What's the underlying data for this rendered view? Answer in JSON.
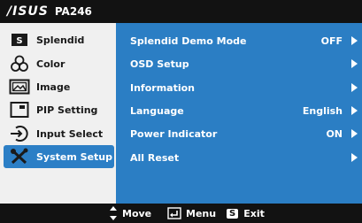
{
  "header": {
    "brand": "/ISUS",
    "model": "PA246"
  },
  "sidebar": {
    "items": [
      {
        "label": "Splendid",
        "icon": "splendid-icon",
        "active": false
      },
      {
        "label": "Color",
        "icon": "color-icon",
        "active": false
      },
      {
        "label": "Image",
        "icon": "image-icon",
        "active": false
      },
      {
        "label": "PIP Setting",
        "icon": "pip-icon",
        "active": false
      },
      {
        "label": "Input Select",
        "icon": "input-select-icon",
        "active": false
      },
      {
        "label": "System Setup",
        "icon": "system-setup-icon",
        "active": true
      }
    ]
  },
  "menu": {
    "rows": [
      {
        "label": "Splendid Demo Mode",
        "value": "OFF"
      },
      {
        "label": "OSD Setup",
        "value": ""
      },
      {
        "label": "Information",
        "value": ""
      },
      {
        "label": "Language",
        "value": "English"
      },
      {
        "label": "Power Indicator",
        "value": "ON"
      },
      {
        "label": "All Reset",
        "value": ""
      }
    ]
  },
  "footer": {
    "move_label": "Move",
    "menu_label": "Menu",
    "exit_key": "S",
    "exit_label": "Exit"
  },
  "colors": {
    "panel_blue": "#2b7ec4",
    "active_blue": "#2c7fc6",
    "bar_black": "#121212",
    "sidebar_bg": "#f0f0f0"
  }
}
